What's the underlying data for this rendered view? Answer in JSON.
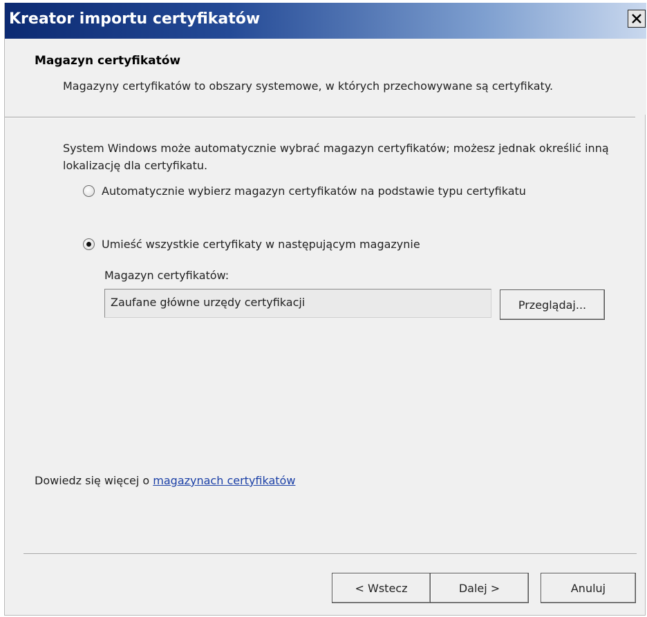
{
  "window": {
    "title": "Kreator importu certyfikatów",
    "close_icon": "close-icon"
  },
  "header": {
    "title": "Magazyn certyfikatów",
    "description": "Magazyny certyfikatów to obszary systemowe, w których przechowywane są certyfikaty."
  },
  "body": {
    "intro": "System Windows może automatycznie wybrać magazyn certyfikatów; możesz jednak określić inną lokalizację dla certyfikatu.",
    "options": [
      {
        "label": "Automatycznie wybierz magazyn certyfikatów na podstawie typu certyfikatu",
        "selected": false
      },
      {
        "label": "Umieść wszystkie certyfikaty w następującym magazynie",
        "selected": true
      }
    ],
    "store_label": "Magazyn certyfikatów:",
    "store_value": "Zaufane główne urzędy certyfikacji",
    "browse_label": "Przeglądaj..."
  },
  "learn_more": {
    "prefix": "Dowiedz się więcej o ",
    "link": "magazynach certyfikatów"
  },
  "footer": {
    "back_label": "< Wstecz",
    "next_label": "Dalej >",
    "cancel_label": "Anuluj"
  }
}
